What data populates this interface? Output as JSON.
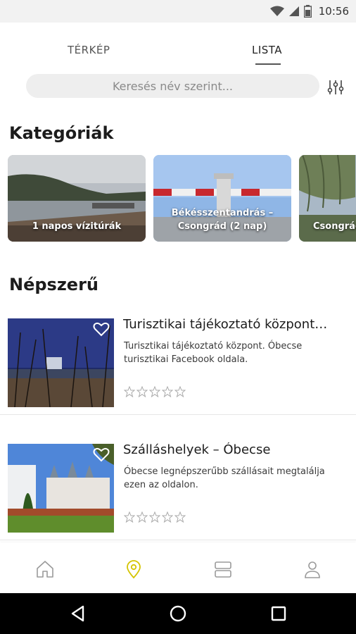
{
  "status_bar": {
    "time": "10:56",
    "icons": [
      "wifi-icon",
      "signal-icon",
      "battery-icon"
    ]
  },
  "tabs": [
    {
      "label": "TÉRKÉP",
      "active": false
    },
    {
      "label": "LISTA",
      "active": true
    }
  ],
  "search": {
    "placeholder": "Keresés név szerint...",
    "filter_icon": "filter-sliders-icon"
  },
  "categories": {
    "title": "Kategóriák",
    "items": [
      {
        "label": "1 napos vízitúrák"
      },
      {
        "label": "Békésszentandrás – Csongrád (2 nap)"
      },
      {
        "label": "Csongrád"
      }
    ]
  },
  "popular": {
    "title": "Népszerű",
    "items": [
      {
        "title": "Turisztikai tájékoztató központ…",
        "description": "Turisztikai tájékoztató központ. Óbecse turisztikai Facebook oldala.",
        "rating": 0,
        "max_rating": 5
      },
      {
        "title": "Szálláshelyek – Óbecse",
        "description": "Óbecse legnépszerűbb szállásait megtalálja ezen az oldalon.",
        "rating": 0,
        "max_rating": 5
      }
    ]
  },
  "bottom_nav": {
    "items": [
      "home-icon",
      "map-pin-icon",
      "cards-icon",
      "profile-icon"
    ],
    "active_color": "#d4c400",
    "inactive_color": "#9a9a9a"
  },
  "system_nav": [
    "back-icon",
    "home-circle-icon",
    "recents-icon"
  ]
}
